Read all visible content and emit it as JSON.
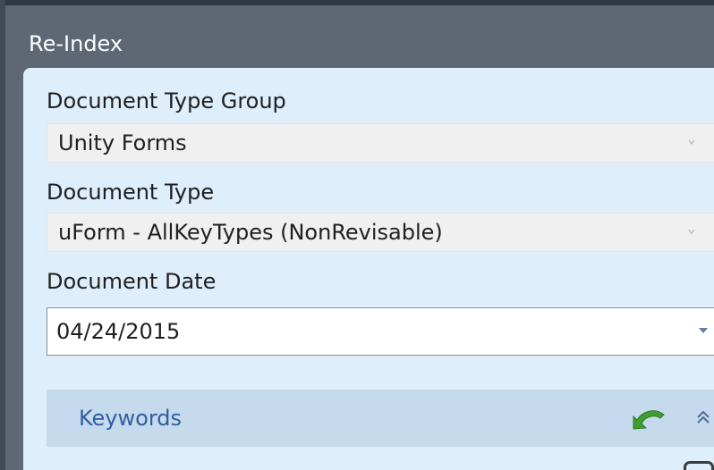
{
  "window": {
    "title": "Re-Index"
  },
  "form": {
    "document_type_group": {
      "label": "Document Type Group",
      "value": "Unity Forms"
    },
    "document_type": {
      "label": "Document Type",
      "value": "uForm - AllKeyTypes (NonRevisable)"
    },
    "document_date": {
      "label": "Document Date",
      "value": "04/24/2015"
    }
  },
  "keywords": {
    "label": "Keywords",
    "icons": [
      "reindex-arrow-icon",
      "collapse-up-icon"
    ]
  },
  "colors": {
    "titlebar": "#5d6874",
    "panel_bg": "#deeefa",
    "section_bar": "#c6daee",
    "section_text": "#2f5f9e",
    "accent_green": "#3f9e2f"
  }
}
